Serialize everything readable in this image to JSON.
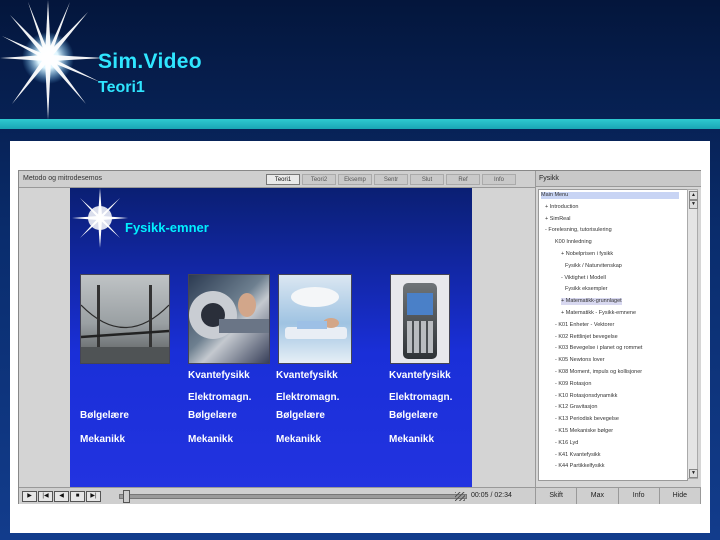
{
  "slide": {
    "title": "Sim.Video",
    "subtitle": "Teori1"
  },
  "app": {
    "doc_title": "Metodo og mitrodesemos",
    "tabs": [
      "Teori1",
      "Teori2",
      "Eksemp",
      "Sentr",
      "Slut",
      "Ref",
      "Info"
    ],
    "active_tab": 0,
    "embedded_slide": {
      "title": "Fysikk-emner",
      "photos": [
        "bridge-photo",
        "mri-scanner-photo",
        "hospital-bed-photo",
        "smartphone-photo"
      ],
      "columns": [
        {
          "items": [
            "Bølgelære",
            "Mekanikk"
          ]
        },
        {
          "items": [
            "Kvantefysikk",
            "Elektromagn.",
            "Bølgelære",
            "Mekanikk"
          ]
        },
        {
          "items": [
            "Kvantefysikk",
            "Elektromagn.",
            "Bølgelære",
            "Mekanikk"
          ]
        },
        {
          "items": [
            "Kvantefysikk",
            "Elektromagn.",
            "Bølgelære",
            "Mekanikk"
          ]
        }
      ]
    },
    "player": {
      "timecode": "00:05 / 02:34",
      "progress": 0.01
    },
    "right_panel": {
      "header": "Fysikk",
      "items": [
        "Main Menu",
        "+  Introduction",
        "+  SimReal",
        "-  Forelesning, tutorisulering",
        "K00 Innledning",
        "+  Nobelprisen i fysikk",
        "Fysikk / Naturvitenskap",
        "-  Viktighet i Modell",
        "Fysikk eksempler",
        "+  Matematikk-grunnlaget",
        "+  Matematikk - Fysikk-emnene",
        "-  K01 Enheter - Vektorer",
        "-  K02 Rettlinjet bevegelse",
        "-  K03 Bevegelse i planet og rommet",
        "-  K05 Newtons lover",
        "-  K08 Moment, impuls og kollisjoner",
        "-  K09 Rotasjon",
        "-  K10 Rotasjonsdynamikk",
        "-  K12 Gravitasjon",
        "-  K13 Periodisk bevegelse",
        "-  K15 Mekaniske bølger",
        "-  K16 Lyd",
        "-  K41 Kvantefysikk",
        "-  K44 Partikkelfysikk"
      ],
      "selected_index": 0,
      "highlight_index": 9,
      "buttons": [
        "Skift",
        "Max",
        "Info",
        "Hide"
      ]
    }
  },
  "colors": {
    "title": "#2fe6ff",
    "accent_bar": "#2ec9d0",
    "slide_title": "#00f0ff"
  }
}
